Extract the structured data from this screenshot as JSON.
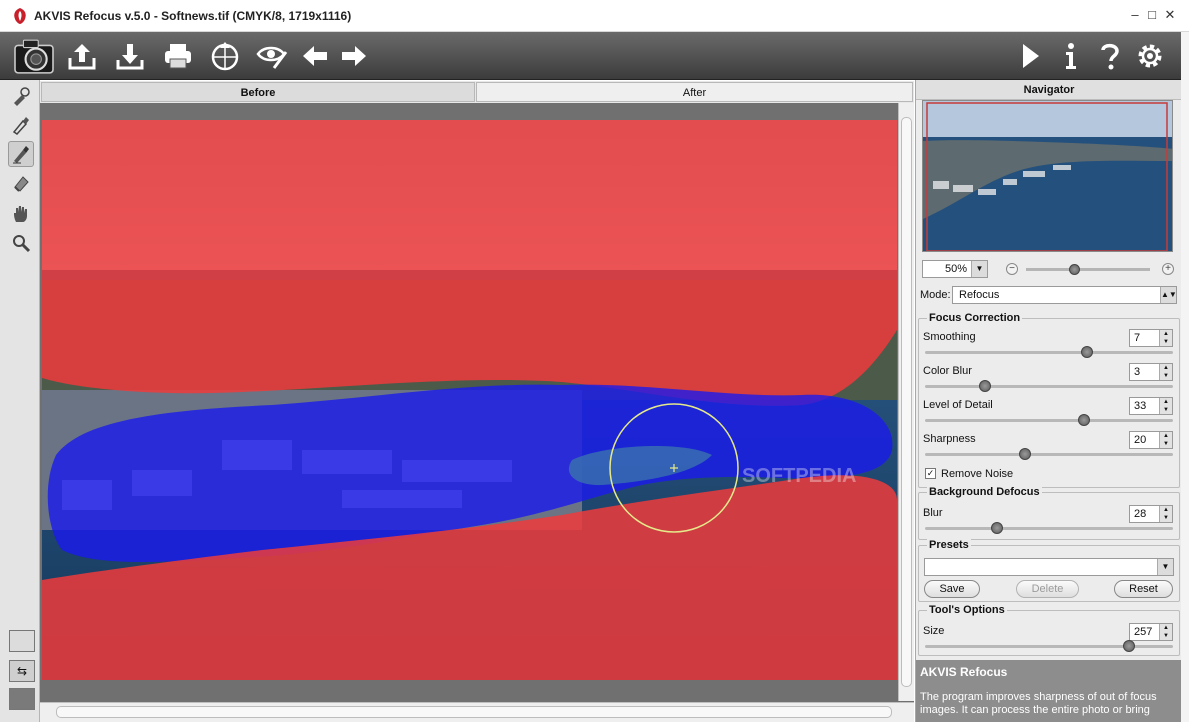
{
  "window": {
    "title": "AKVIS Refocus v.5.0 - Softnews.tif (CMYK/8, 1719x1116)",
    "minimize": "–",
    "maximize": "□",
    "close": "✕"
  },
  "toolbar": {
    "icons": [
      "camera-icon",
      "upload-icon",
      "download-icon",
      "print-icon",
      "share-icon",
      "preview-eye-icon",
      "undo-arrow-icon",
      "redo-arrow-icon",
      "run-play-icon",
      "info-icon",
      "help-icon",
      "settings-gear-icon"
    ]
  },
  "lefttools": {
    "icons": [
      "focus-brush-icon",
      "background-brush-icon",
      "keep-brush-icon",
      "eraser-icon",
      "hand-icon",
      "zoom-icon"
    ]
  },
  "view": {
    "tab_before": "Before",
    "tab_after": "After"
  },
  "navigator": {
    "title": "Navigator",
    "zoom": "50%"
  },
  "mode": {
    "label": "Mode:",
    "value": "Refocus"
  },
  "focus_correction": {
    "title": "Focus Correction",
    "params": [
      {
        "label": "Smoothing",
        "value": "7",
        "fraction": 0.66
      },
      {
        "label": "Color Blur",
        "value": "3",
        "fraction": 0.23
      },
      {
        "label": "Level of Detail",
        "value": "33",
        "fraction": 0.65
      },
      {
        "label": "Sharpness",
        "value": "20",
        "fraction": 0.4
      }
    ],
    "remove_noise_label": "Remove Noise",
    "remove_noise_checked": "✓"
  },
  "background_defocus": {
    "title": "Background Defocus",
    "blur_label": "Blur",
    "blur_value": "28",
    "blur_fraction": 0.28
  },
  "presets": {
    "title": "Presets",
    "value": "",
    "save": "Save",
    "delete": "Delete",
    "reset": "Reset"
  },
  "tool_options": {
    "title": "Tool's Options",
    "size_label": "Size",
    "size_value": "257",
    "size_fraction": 0.84
  },
  "help": {
    "title": "AKVIS Refocus",
    "text": "The program improves sharpness of out of focus images. It can process the entire photo or bring"
  },
  "watermark": "SOFTPEDIA",
  "colors": {
    "keep_mask": "#ee3b3b",
    "focus_mask": "#1a1aee",
    "brush_ring": "#e5e98a",
    "toolbar_dark": "#3c3c3c"
  }
}
